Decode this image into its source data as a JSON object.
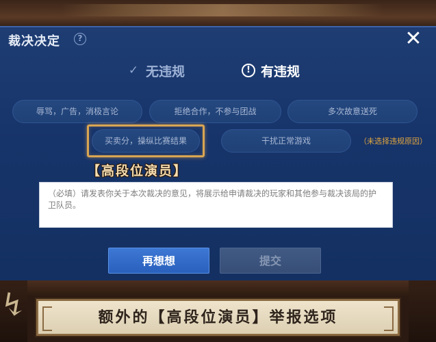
{
  "dialog": {
    "title": "裁决决定",
    "help_icon": "?",
    "close_icon": "✕"
  },
  "verdict": {
    "no_violation": {
      "label": "无违规",
      "icon": "check-icon"
    },
    "violation": {
      "label": "有违规",
      "icon": "exclamation-icon",
      "selected": true
    }
  },
  "reasons": [
    {
      "label": "辱骂，广告，消极言论",
      "selected": false
    },
    {
      "label": "拒绝合作，不参与团战",
      "selected": false
    },
    {
      "label": "多次故意送死",
      "selected": false
    },
    {
      "label": "买卖分，操纵比赛结果",
      "selected": false,
      "highlighted": true
    },
    {
      "label": "干扰正常游戏",
      "selected": false
    }
  ],
  "unselected_hint": "（未选择违规原因）",
  "highlight_tag": "【高段位演员】",
  "opinion": {
    "placeholder": "（必填）请发表你关于本次裁决的意见，将展示给申请裁决的玩家和其他参与裁决该局的护卫队员。"
  },
  "buttons": {
    "rethink": "再想想",
    "submit": "提交"
  },
  "caption": "额外的【高段位演员】举报选项",
  "colors": {
    "dialog_bg": "#17346a",
    "highlight_border": "#d9a552",
    "hint_orange": "#e2a63d",
    "primary_button": "#2f66c4",
    "disabled_button": "#3b5279"
  }
}
